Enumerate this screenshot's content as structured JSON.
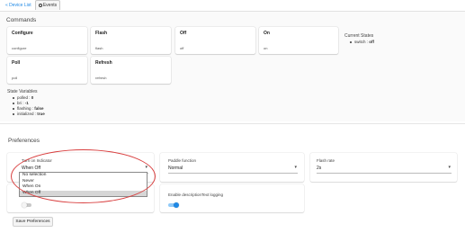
{
  "nav": {
    "back_label": "« Device List",
    "events_tab": "Events",
    "events_icon": "clock-icon"
  },
  "commands": {
    "heading": "Commands",
    "items": [
      {
        "title": "Configure",
        "sub": "configure"
      },
      {
        "title": "Flash",
        "sub": "flash"
      },
      {
        "title": "Off",
        "sub": "off"
      },
      {
        "title": "On",
        "sub": "on"
      },
      {
        "title": "Poll",
        "sub": "poll"
      },
      {
        "title": "Refresh",
        "sub": "refresh"
      }
    ]
  },
  "current_states": {
    "title": "Current States",
    "items": [
      {
        "key": "switch",
        "sep": " : ",
        "value": "off"
      }
    ]
  },
  "state_variables": {
    "title": "State Variables",
    "items": [
      {
        "key": "polled",
        "sep": " : ",
        "value": "0"
      },
      {
        "key": "bri",
        "sep": " : ",
        "value": "-1"
      },
      {
        "key": "flashing",
        "sep": " : ",
        "value": "false"
      },
      {
        "key": "initialized",
        "sep": " : ",
        "value": "true"
      }
    ]
  },
  "preferences": {
    "heading": "Preferences",
    "turn_on_indicator": {
      "label": "Turn on Indicator",
      "value": "When Off",
      "options": [
        "No selection",
        "Never",
        "When On",
        "When Off"
      ],
      "selected_index": 3
    },
    "paddle_function": {
      "label": "Paddle function",
      "value": "Normal"
    },
    "flash_rate": {
      "label": "Flash rate",
      "value": "2s"
    },
    "debug_logging": {
      "label": "Enable debug logging",
      "on": false
    },
    "desc_logging": {
      "label": "Enable descriptionText logging",
      "on": true
    },
    "save_label": "Save Preferences"
  },
  "colors": {
    "accent": "#1e88e5",
    "annotation": "#d94040"
  }
}
